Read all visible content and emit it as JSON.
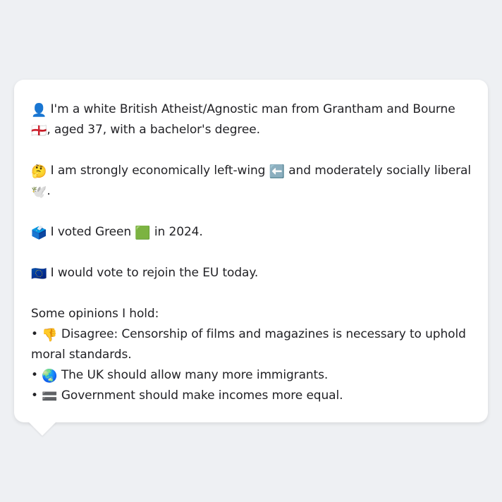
{
  "profile": {
    "intro": {
      "icon": "👤",
      "icon_name": "person-silhouette-icon",
      "text_before_flag": " I'm a white British Atheist/Agnostic man from Grantham and Bourne ",
      "flag": "🏴󠁧󠁢󠁥󠁮󠁧󠁿",
      "flag_name": "england-flag-icon",
      "text_after_flag": ", aged 37, with a bachelor's degree."
    },
    "ideology": {
      "icon": "🤔",
      "icon_name": "thinking-face-icon",
      "text_before_arrow": " I am strongly economically left-wing ",
      "arrow": "⬅️",
      "arrow_name": "left-arrow-icon",
      "text_after_arrow": " and moderately socially liberal ",
      "dove": "🕊️",
      "dove_name": "dove-icon",
      "text_end": "."
    },
    "vote": {
      "icon": "🗳️",
      "icon_name": "ballot-box-icon",
      "text_before_square": " I voted Green ",
      "square": "🟩",
      "square_name": "green-square-icon",
      "text_after_square": " in 2024."
    },
    "eu": {
      "icon": "🇪🇺",
      "icon_name": "eu-flag-icon",
      "text": " I would vote to rejoin the EU today."
    },
    "opinions": {
      "heading": "Some opinions I hold:",
      "items": [
        {
          "bullet": "• ",
          "icon": "👎",
          "icon_name": "thumbs-down-icon",
          "text": " Disagree: Censorship of films and magazines is necessary to uphold moral standards."
        },
        {
          "bullet": "• ",
          "icon": "🌏",
          "icon_name": "globe-icon",
          "text": " The UK should allow many more immigrants."
        },
        {
          "bullet": "• ",
          "icon": "🟰",
          "icon_name": "equals-sign-icon",
          "text": " Government should make incomes more equal."
        }
      ]
    }
  }
}
